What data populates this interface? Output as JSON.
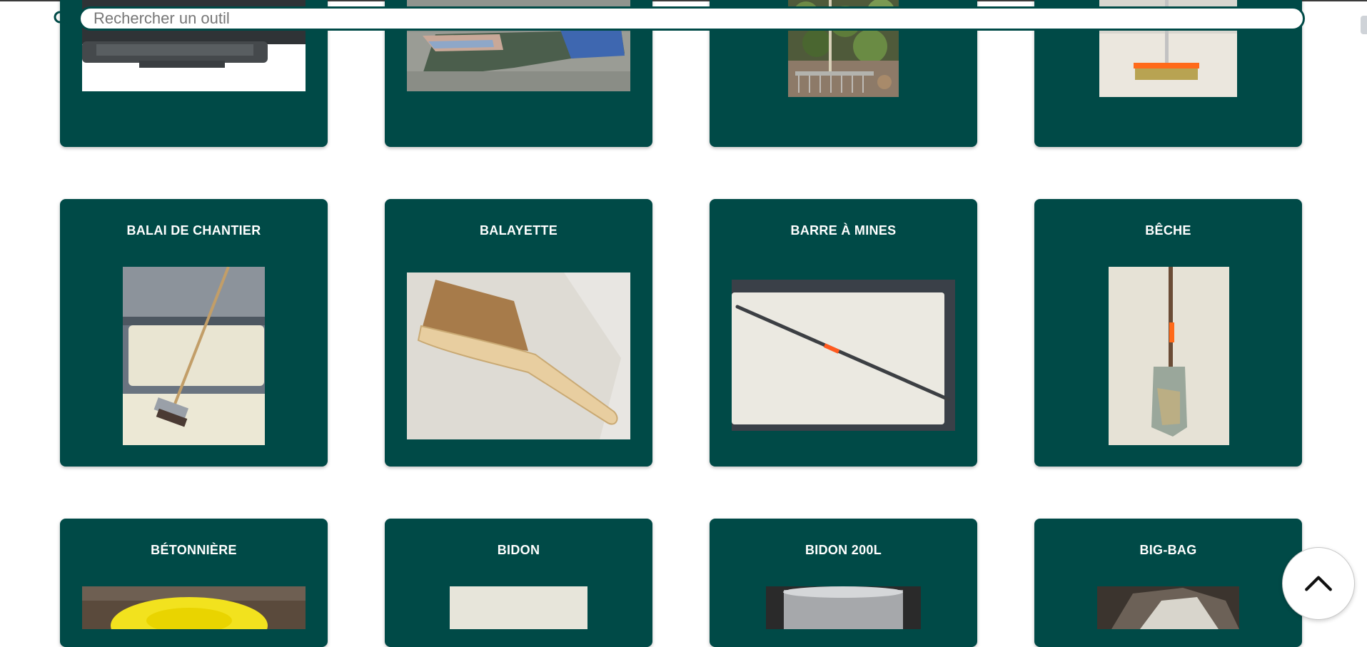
{
  "search": {
    "placeholder": "Rechercher un outil",
    "value": ""
  },
  "tools": {
    "row_top": [
      {
        "name": "",
        "image": "plastic-tray-photo"
      },
      {
        "name": "",
        "image": "tarps-photo"
      },
      {
        "name": "",
        "image": "rake-photo"
      },
      {
        "name": "",
        "image": "push-broom-photo"
      }
    ],
    "row_middle": [
      {
        "name": "BALAI DE CHANTIER",
        "image": "site-broom-photo"
      },
      {
        "name": "BALAYETTE",
        "image": "hand-brush-photo"
      },
      {
        "name": "BARRE À MINES",
        "image": "crowbar-photo"
      },
      {
        "name": "BÊCHE",
        "image": "spade-photo"
      }
    ],
    "row_bottom": [
      {
        "name": "BÉTONNIÈRE",
        "image": "concrete-mixer-photo"
      },
      {
        "name": "BIDON",
        "image": "container-photo"
      },
      {
        "name": "BIDON 200L",
        "image": "drum-200l-photo"
      },
      {
        "name": "BIG-BAG",
        "image": "big-bag-photo"
      }
    ]
  },
  "colors": {
    "card_background": "#004a47",
    "card_text": "#ffffff",
    "search_border": "#004a47"
  },
  "icons": {
    "search": "search-icon",
    "back_to_top": "chevron-up-icon"
  }
}
